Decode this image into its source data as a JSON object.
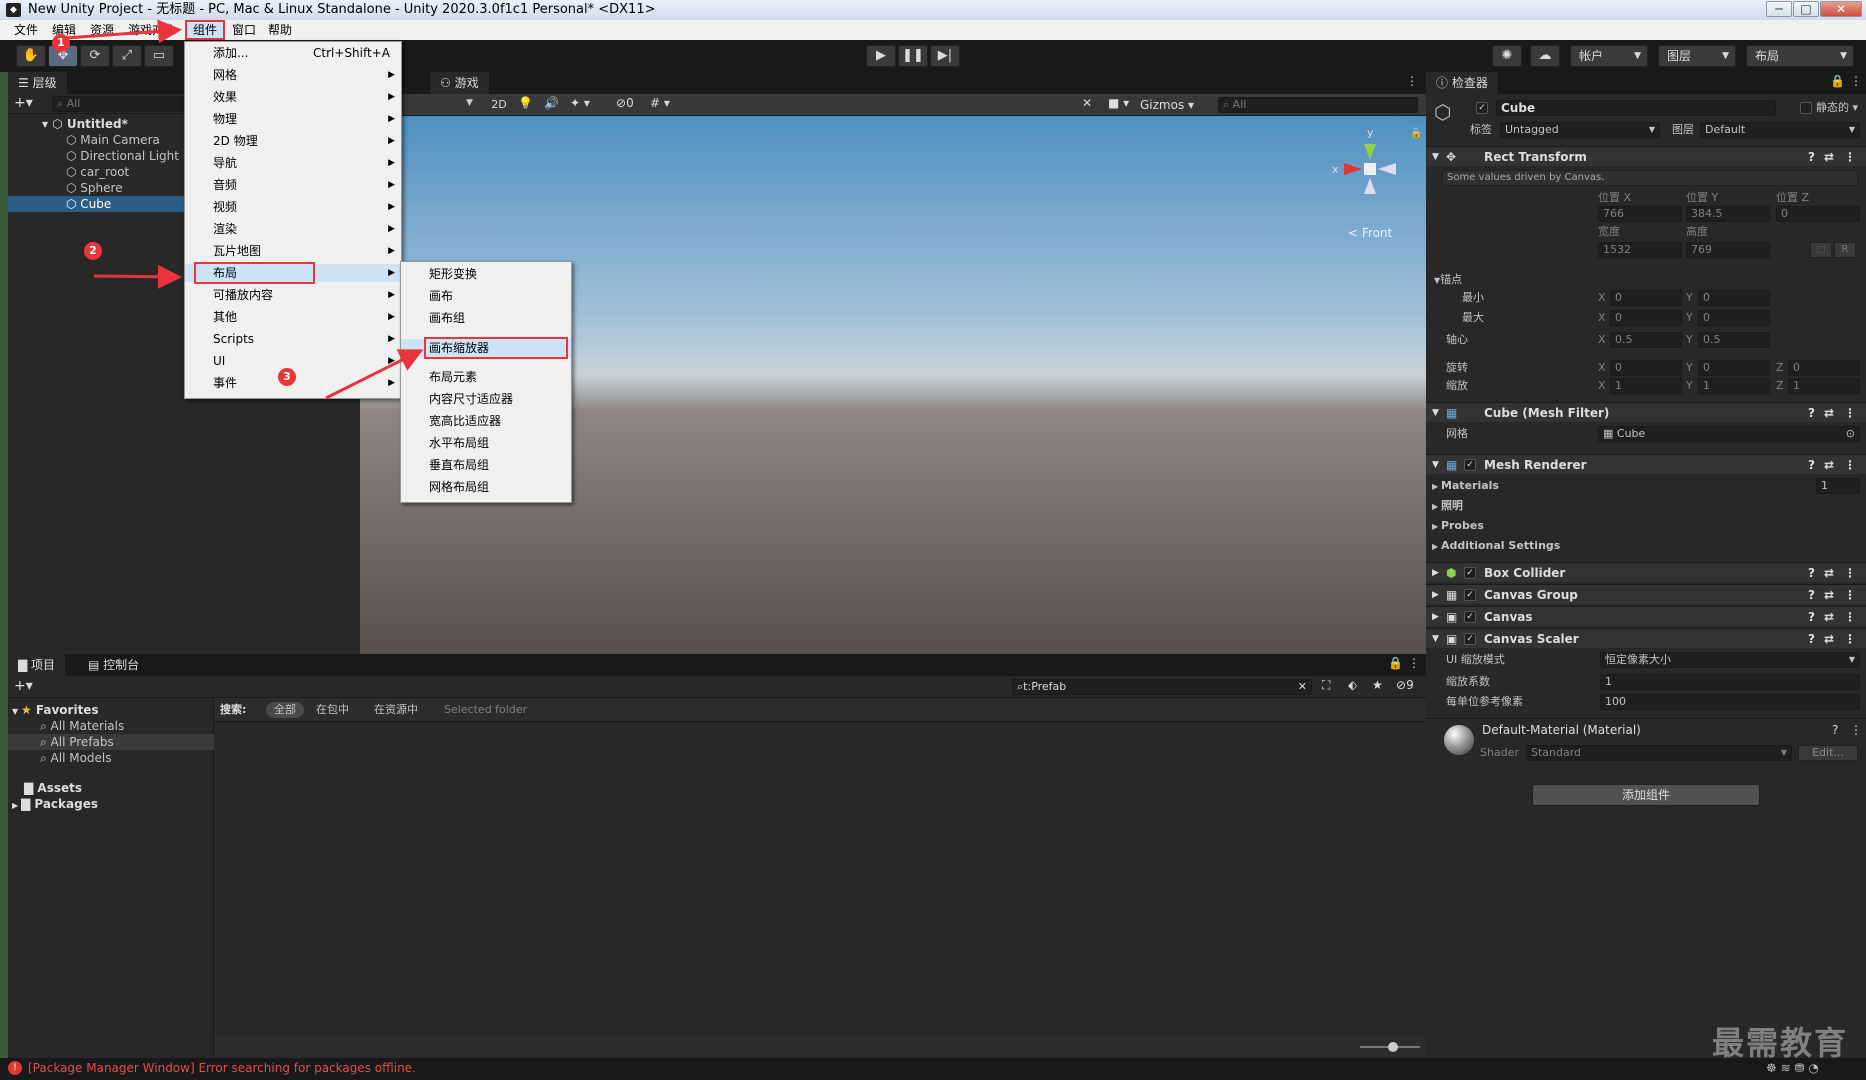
{
  "window": {
    "title": "New Unity Project - 无标题 - PC, Mac & Linux Standalone - Unity 2020.3.0f1c1 Personal* <DX11>",
    "minimize": "─",
    "maximize": "□",
    "close": "✕"
  },
  "menubar": {
    "items": [
      "文件",
      "编辑",
      "资源",
      "游戏对象",
      "组件",
      "窗口",
      "帮助"
    ]
  },
  "toolbar": {
    "account": "帐户",
    "layers": "图层",
    "layout": "布局"
  },
  "hierarchy": {
    "tab": "层级",
    "search_placeholder": "All",
    "scene": "Untitled*",
    "items": [
      "Main Camera",
      "Directional Light",
      "car_root",
      "Sphere",
      "Cube"
    ],
    "selected": "Cube"
  },
  "scene": {
    "game_tab": "游戏",
    "mode_2d": "2D",
    "hidden_count": "0",
    "gizmos": "Gizmos",
    "search_placeholder": "All",
    "axis_y": "y",
    "axis_x": "x",
    "view_label": "< Front"
  },
  "component_menu": {
    "items": [
      {
        "label": "添加...",
        "shortcut": "Ctrl+Shift+A",
        "sub": false
      },
      {
        "label": "网格",
        "sub": true
      },
      {
        "label": "效果",
        "sub": true
      },
      {
        "label": "物理",
        "sub": true
      },
      {
        "label": "2D 物理",
        "sub": true
      },
      {
        "label": "导航",
        "sub": true
      },
      {
        "label": "音频",
        "sub": true
      },
      {
        "label": "视频",
        "sub": true
      },
      {
        "label": "渲染",
        "sub": true
      },
      {
        "label": "瓦片地图",
        "sub": true
      },
      {
        "label": "布局",
        "sub": true
      },
      {
        "label": "可播放内容",
        "sub": true
      },
      {
        "label": "其他",
        "sub": true
      },
      {
        "label": "Scripts",
        "sub": true
      },
      {
        "label": "UI",
        "sub": true
      },
      {
        "label": "事件",
        "sub": true
      }
    ]
  },
  "layout_submenu": {
    "items": [
      "矩形变换",
      "画布",
      "画布组",
      "画布缩放器",
      "布局元素",
      "内容尺寸适应器",
      "宽高比适应器",
      "水平布局组",
      "垂直布局组",
      "网格布局组"
    ]
  },
  "annotations": [
    "1",
    "2",
    "3"
  ],
  "project": {
    "tab_project": "项目",
    "tab_console": "控制台",
    "search_value": "t:Prefab",
    "hidden_count": "9",
    "filter_label": "搜索:",
    "filters": [
      "全部",
      "在包中",
      "在资源中",
      "Selected folder"
    ],
    "favorites": "Favorites",
    "fav_items": [
      "All Materials",
      "All Prefabs",
      "All Models"
    ],
    "assets": "Assets",
    "packages": "Packages"
  },
  "status": {
    "error": "[Package Manager Window] Error searching for packages offline.",
    "watermark": "最需教育"
  },
  "inspector": {
    "tab": "检查器",
    "name": "Cube",
    "static": "静态的",
    "tag_label": "标签",
    "tag": "Untagged",
    "layer_label": "图层",
    "layer": "Default",
    "rect_transform": {
      "title": "Rect Transform",
      "note": "Some values driven by Canvas.",
      "pos_x_label": "位置 X",
      "pos_y_label": "位置 Y",
      "pos_z_label": "位置 Z",
      "pos_x": "766",
      "pos_y": "384.5",
      "pos_z": "0",
      "width_label": "宽度",
      "height_label": "高度",
      "width": "1532",
      "height": "769",
      "r_button": "R",
      "anchors_label": "锚点",
      "min_label": "最小",
      "max_label": "最大",
      "min_x": "0",
      "min_y": "0",
      "max_x": "0",
      "max_y": "0",
      "pivot_label": "轴心",
      "pivot_x": "0.5",
      "pivot_y": "0.5",
      "rotation_label": "旋转",
      "rot_x": "0",
      "rot_y": "0",
      "rot_z": "0",
      "scale_label": "缩放",
      "scale_x": "1",
      "scale_y": "1",
      "scale_z": "1",
      "x": "X",
      "y": "Y",
      "z": "Z"
    },
    "mesh_filter": {
      "title": "Cube (Mesh Filter)",
      "mesh_label": "网格",
      "mesh": "Cube"
    },
    "mesh_renderer": {
      "title": "Mesh Renderer",
      "materials": "Materials",
      "materials_count": "1",
      "lighting": "照明",
      "probes": "Probes",
      "additional": "Additional Settings"
    },
    "box_collider": "Box Collider",
    "canvas_group": "Canvas Group",
    "canvas": "Canvas",
    "canvas_scaler": {
      "title": "Canvas Scaler",
      "mode_label": "UI 缩放模式",
      "mode": "恒定像素大小",
      "scale_label": "缩放系数",
      "scale": "1",
      "ppu_label": "每单位参考像素",
      "ppu": "100"
    },
    "material": {
      "title": "Default-Material (Material)",
      "shader_label": "Shader",
      "shader": "Standard",
      "edit": "Edit..."
    },
    "add_component": "添加组件"
  }
}
